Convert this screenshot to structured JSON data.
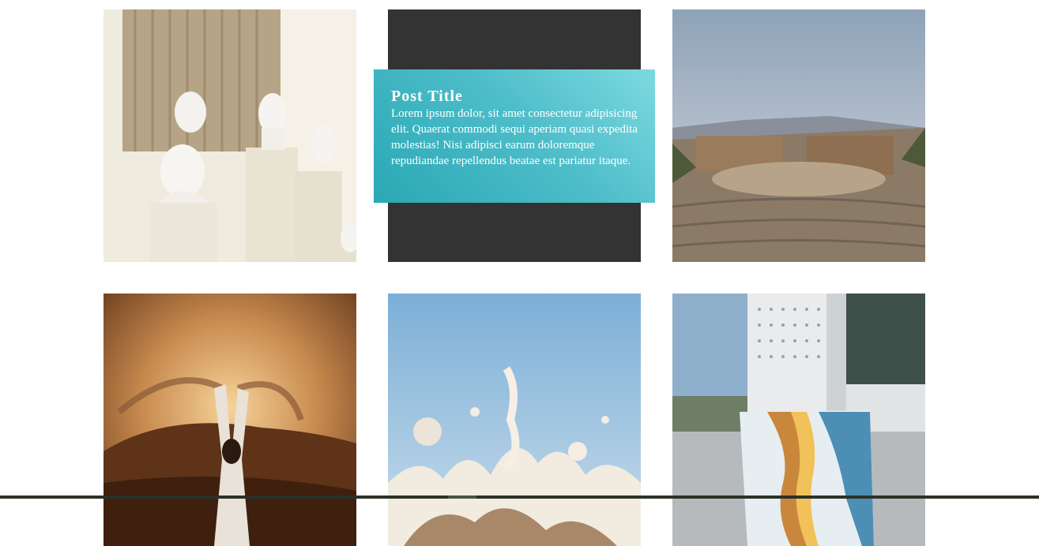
{
  "gallery": {
    "tiles": [
      {
        "name": "statues",
        "image": "white-busts-on-pedestals-photo"
      },
      {
        "name": "post-card",
        "image": "dark-placeholder",
        "caption": {
          "title": "Post Title",
          "body": "Lorem ipsum dolor, sit amet consectetur adipisicing elit. Quaerat commodi sequi aperiam quasi expedita molestias! Nisi adipisci earum doloremque repudiandae repellendus beatae est pariatur itaque."
        }
      },
      {
        "name": "amphitheater",
        "image": "ancient-theater-ruins-photo"
      },
      {
        "name": "desert",
        "image": "sand-throw-sunset-photo"
      },
      {
        "name": "splash",
        "image": "milk-splash-sky-photo"
      },
      {
        "name": "laptop",
        "image": "agate-laptop-balcony-photo"
      }
    ]
  },
  "colors": {
    "caption_bg": "#4dbdc9",
    "card_bg": "#333333",
    "bottom_bar": "#2b3228"
  }
}
